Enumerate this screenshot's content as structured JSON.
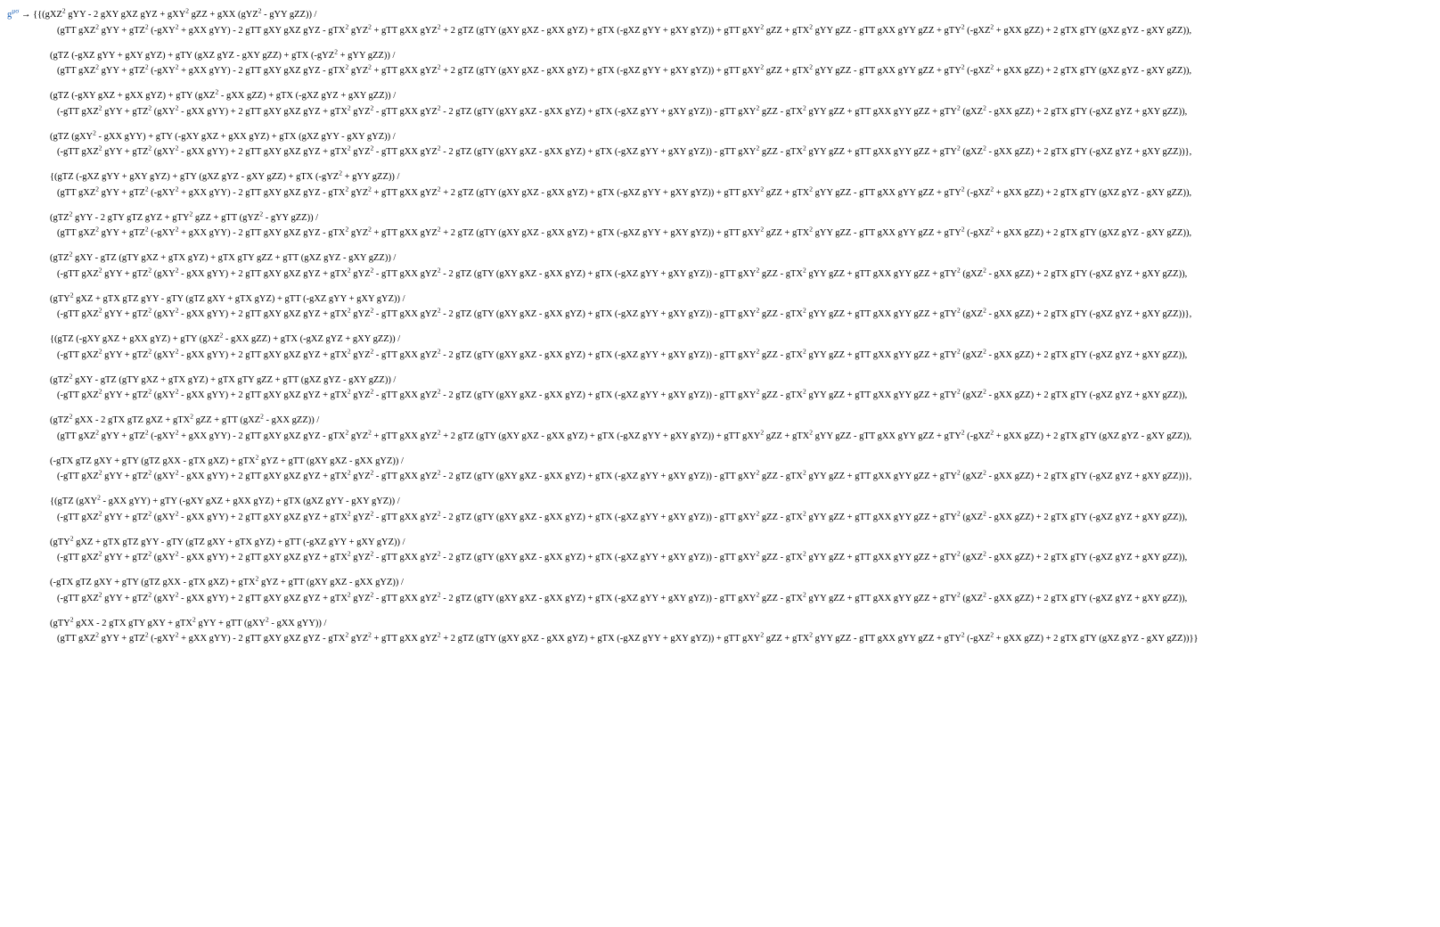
{
  "lhs": "g",
  "lhs_sup": "μσ",
  "arrow": " → ",
  "denom_pos": "(gTT gXZ² gYY + gTZ² (-gXY² + gXX gYY) - 2 gTT gXY gXZ gYZ - gTX² gYZ² + gTT gXX gYZ² + 2 gTZ (gTY (gXY gXZ - gXX gYZ) + gTX (-gXZ gYY + gXY gYZ)) + gTT gXY² gZZ + gTX² gYY gZZ - gTT gXX gYY gZZ + gTY² (-gXZ² + gXX gZZ) + 2 gTX gTY (gXZ gYZ - gXY gZZ)),",
  "denom_neg": "(-gTT gXZ² gYY + gTZ² (gXY² - gXX gYY) + 2 gTT gXY gXZ gYZ + gTX² gYZ² - gTT gXX gYZ² - 2 gTZ (gTY (gXY gXZ - gXX gYZ) + gTX (-gXZ gYY + gXY gYZ)) - gTT gXY² gZZ - gTX² gYY gZZ + gTT gXX gYY gZZ + gTY² (gXZ² - gXX gZZ) + 2 gTX gTY (-gXZ gYZ + gXY gZZ)),",
  "denom_neg_end": "(-gTT gXZ² gYY + gTZ² (gXY² - gXX gYY) + 2 gTT gXY gXZ gYZ + gTX² gYZ² - gTT gXX gYZ² - 2 gTZ (gTY (gXY gXZ - gXX gYZ) + gTX (-gXZ gYY + gXY gYZ)) - gTT gXY² gZZ - gTX² gYY gZZ + gTT gXX gYY gZZ + gTY² (gXZ² - gXX gZZ) + 2 gTX gTY (-gXZ gYZ + gXY gZZ))},",
  "denom_pos_final": "(gTT gXZ² gYY + gTZ² (-gXY² + gXX gYY) - 2 gTT gXY gXZ gYZ - gTX² gYZ² + gTT gXX gYZ² + 2 gTZ (gTY (gXY gXZ - gXX gYZ) + gTX (-gXZ gYY + gXY gYZ)) + gTT gXY² gZZ + gTX² gYY gZZ - gTT gXX gYY gZZ + gTY² (-gXZ² + gXX gZZ) + 2 gTX gTY (gXZ gYZ - gXY gZZ))}}",
  "num": {
    "r1c1": "{{(gXZ² gYY - 2 gXY gXZ gYZ + gXY² gZZ + gXX (gYZ² - gYY gZZ)) /",
    "r1c2": "(gTZ (-gXZ gYY + gXY gYZ) + gTY (gXZ gYZ - gXY gZZ) + gTX (-gYZ² + gYY gZZ)) /",
    "r1c3": "(gTZ (-gXY gXZ + gXX gYZ) + gTY (gXZ² - gXX gZZ) + gTX (-gXZ gYZ + gXY gZZ)) /",
    "r1c4": "(gTZ (gXY² - gXX gYY) + gTY (-gXY gXZ + gXX gYZ) + gTX (gXZ gYY - gXY gYZ)) /",
    "r2c1": "{(gTZ (-gXZ gYY + gXY gYZ) + gTY (gXZ gYZ - gXY gZZ) + gTX (-gYZ² + gYY gZZ)) /",
    "r2c2": "(gTZ² gYY - 2 gTY gTZ gYZ + gTY² gZZ + gTT (gYZ² - gYY gZZ)) /",
    "r2c3": "(gTZ² gXY - gTZ (gTY gXZ + gTX gYZ) + gTX gTY gZZ + gTT (gXZ gYZ - gXY gZZ)) /",
    "r2c4": "(gTY² gXZ + gTX gTZ gYY - gTY (gTZ gXY + gTX gYZ) + gTT (-gXZ gYY + gXY gYZ)) /",
    "r3c1": "{(gTZ (-gXY gXZ + gXX gYZ) + gTY (gXZ² - gXX gZZ) + gTX (-gXZ gYZ + gXY gZZ)) /",
    "r3c2": "(gTZ² gXY - gTZ (gTY gXZ + gTX gYZ) + gTX gTY gZZ + gTT (gXZ gYZ - gXY gZZ)) /",
    "r3c3": "(gTZ² gXX - 2 gTX gTZ gXZ + gTX² gZZ + gTT (gXZ² - gXX gZZ)) /",
    "r3c4": "(-gTX gTZ gXY + gTY (gTZ gXX - gTX gXZ) + gTX² gYZ + gTT (gXY gXZ - gXX gYZ)) /",
    "r4c1": "{(gTZ (gXY² - gXX gYY) + gTY (-gXY gXZ + gXX gYZ) + gTX (gXZ gYY - gXY gYZ)) /",
    "r4c2": "(gTY² gXZ + gTX gTZ gYY - gTY (gTZ gXY + gTX gYZ) + gTT (-gXZ gYY + gXY gYZ)) /",
    "r4c3": "(-gTX gTZ gXY + gTY (gTZ gXX - gTX gXZ) + gTX² gYZ + gTT (gXY gXZ - gXX gYZ)) /",
    "r4c4": "(gTY² gXX - 2 gTX gTY gXY + gTX² gYY + gTT (gXY² - gXX gYY)) /"
  }
}
